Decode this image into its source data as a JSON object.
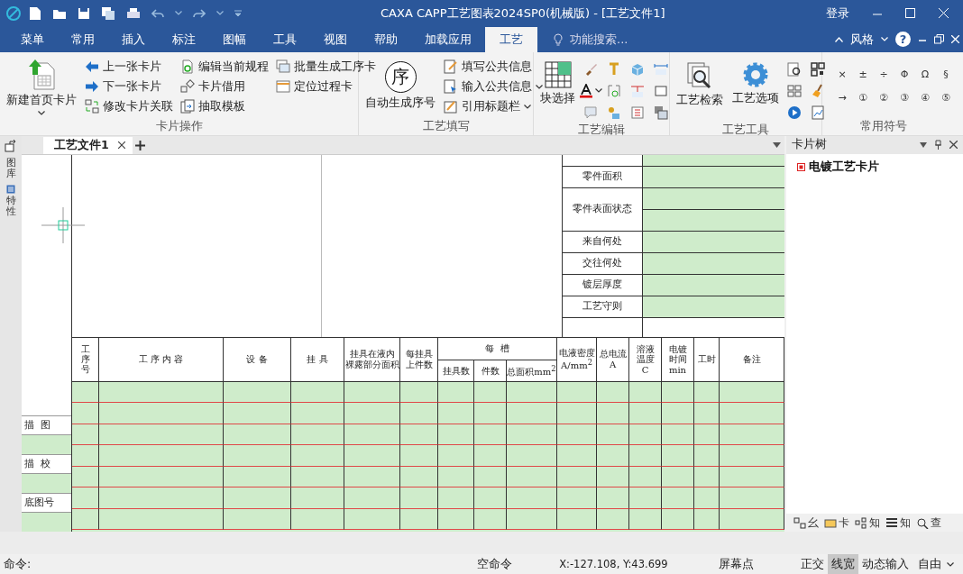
{
  "window": {
    "title": "CAXA CAPP工艺图表2024SP0(机械版) - [工艺文件1]",
    "login": "登录"
  },
  "ribbon_tabs": [
    {
      "label": "菜单",
      "selected": false
    },
    {
      "label": "常用",
      "selected": false
    },
    {
      "label": "插入",
      "selected": false
    },
    {
      "label": "标注",
      "selected": false
    },
    {
      "label": "图幅",
      "selected": false
    },
    {
      "label": "工具",
      "selected": false
    },
    {
      "label": "视图",
      "selected": false
    },
    {
      "label": "帮助",
      "selected": false
    },
    {
      "label": "加载应用",
      "selected": false
    },
    {
      "label": "工艺",
      "selected": true
    }
  ],
  "search": {
    "placeholder": "功能搜索..."
  },
  "style_menu": {
    "label": "风格",
    "help": "?"
  },
  "card_ops": {
    "title": "卡片操作",
    "large": "新建首页卡片",
    "columns": [
      [
        "上一张卡片",
        "下一张卡片",
        "修改卡片关联"
      ],
      [
        "编辑当前规程",
        "卡片借用",
        "抽取模板"
      ],
      [
        "批量生成工序卡",
        "定位过程卡"
      ]
    ]
  },
  "fill_in": {
    "title": "工艺填写",
    "large": "自动生成序号",
    "large_glyph": "序",
    "items": [
      {
        "label": "填写公共信息",
        "dropdown": false
      },
      {
        "label": "输入公共信息",
        "dropdown": true
      },
      {
        "label": "引用标题栏",
        "dropdown": true
      }
    ]
  },
  "edit": {
    "title": "工艺编辑",
    "large": "块选择"
  },
  "tools": {
    "title": "工艺工具",
    "large": [
      "工艺检索",
      "工艺选项"
    ]
  },
  "symbols": {
    "title": "常用符号",
    "items": [
      "×",
      "±",
      "÷",
      "Φ",
      "Ω",
      "§",
      "→",
      "①",
      "②",
      "③",
      "④",
      "⑤"
    ]
  },
  "doc_tabs": [
    {
      "label": "工艺文件1",
      "selected": true
    }
  ],
  "side_tabs": [
    "图库",
    "特性"
  ],
  "form": {
    "right_rows": [
      {
        "label": "零件面积",
        "kind": "single"
      },
      {
        "label": "零件表面状态",
        "kind": "double"
      },
      {
        "label": "来自何处",
        "kind": "single"
      },
      {
        "label": "交往何处",
        "kind": "single"
      },
      {
        "label": "镀层厚度",
        "kind": "single"
      },
      {
        "label": "工艺守则",
        "kind": "single"
      },
      {
        "label": "",
        "kind": "blank"
      }
    ],
    "group_header": "每  槽",
    "columns": [
      {
        "lines": [
          "工序号"
        ],
        "kind": "vertical"
      },
      {
        "lines": [
          "工 序 内 容"
        ],
        "kind": "single"
      },
      {
        "lines": [
          "设 备"
        ],
        "kind": "single"
      },
      {
        "lines": [
          "挂 具"
        ],
        "kind": "single"
      },
      {
        "lines": [
          "挂具在液内",
          "裸露部分面积"
        ],
        "kind": "single"
      },
      {
        "lines": [
          "每挂具",
          "上件数"
        ],
        "kind": "single"
      },
      {
        "lines": [
          "挂具数"
        ],
        "kind": "sub"
      },
      {
        "lines": [
          "件数"
        ],
        "kind": "sub"
      },
      {
        "lines": [
          "总面积mm$^{2}$"
        ],
        "kind": "sub"
      },
      {
        "lines": [
          "电液密度",
          "A/mm$^{2}$"
        ],
        "kind": "single"
      },
      {
        "lines": [
          "总电流",
          "A"
        ],
        "kind": "single"
      },
      {
        "lines": [
          "溶液",
          "温度",
          "C"
        ],
        "kind": "single"
      },
      {
        "lines": [
          "电镀",
          "时间",
          "min"
        ],
        "kind": "single"
      },
      {
        "lines": [
          "工时"
        ],
        "kind": "single"
      },
      {
        "lines": [
          "备注"
        ],
        "kind": "single"
      }
    ],
    "side_labels": [
      "描  图",
      "描  校",
      "底图号"
    ]
  },
  "panel": {
    "title": "卡片树",
    "tree": [
      {
        "label": "电镀工艺卡片",
        "selected": false
      }
    ],
    "bottom_tabs": [
      "幺",
      "卡",
      "知",
      "知",
      "查"
    ]
  },
  "status": {
    "command": "命令:",
    "state": "空命令",
    "coords": "X:-127.108, Y:43.699",
    "snap": "屏幕点",
    "toggles": [
      {
        "label": "正交",
        "on": false
      },
      {
        "label": "线宽",
        "on": true
      },
      {
        "label": "动态输入",
        "on": false
      }
    ],
    "mode": "自由"
  }
}
